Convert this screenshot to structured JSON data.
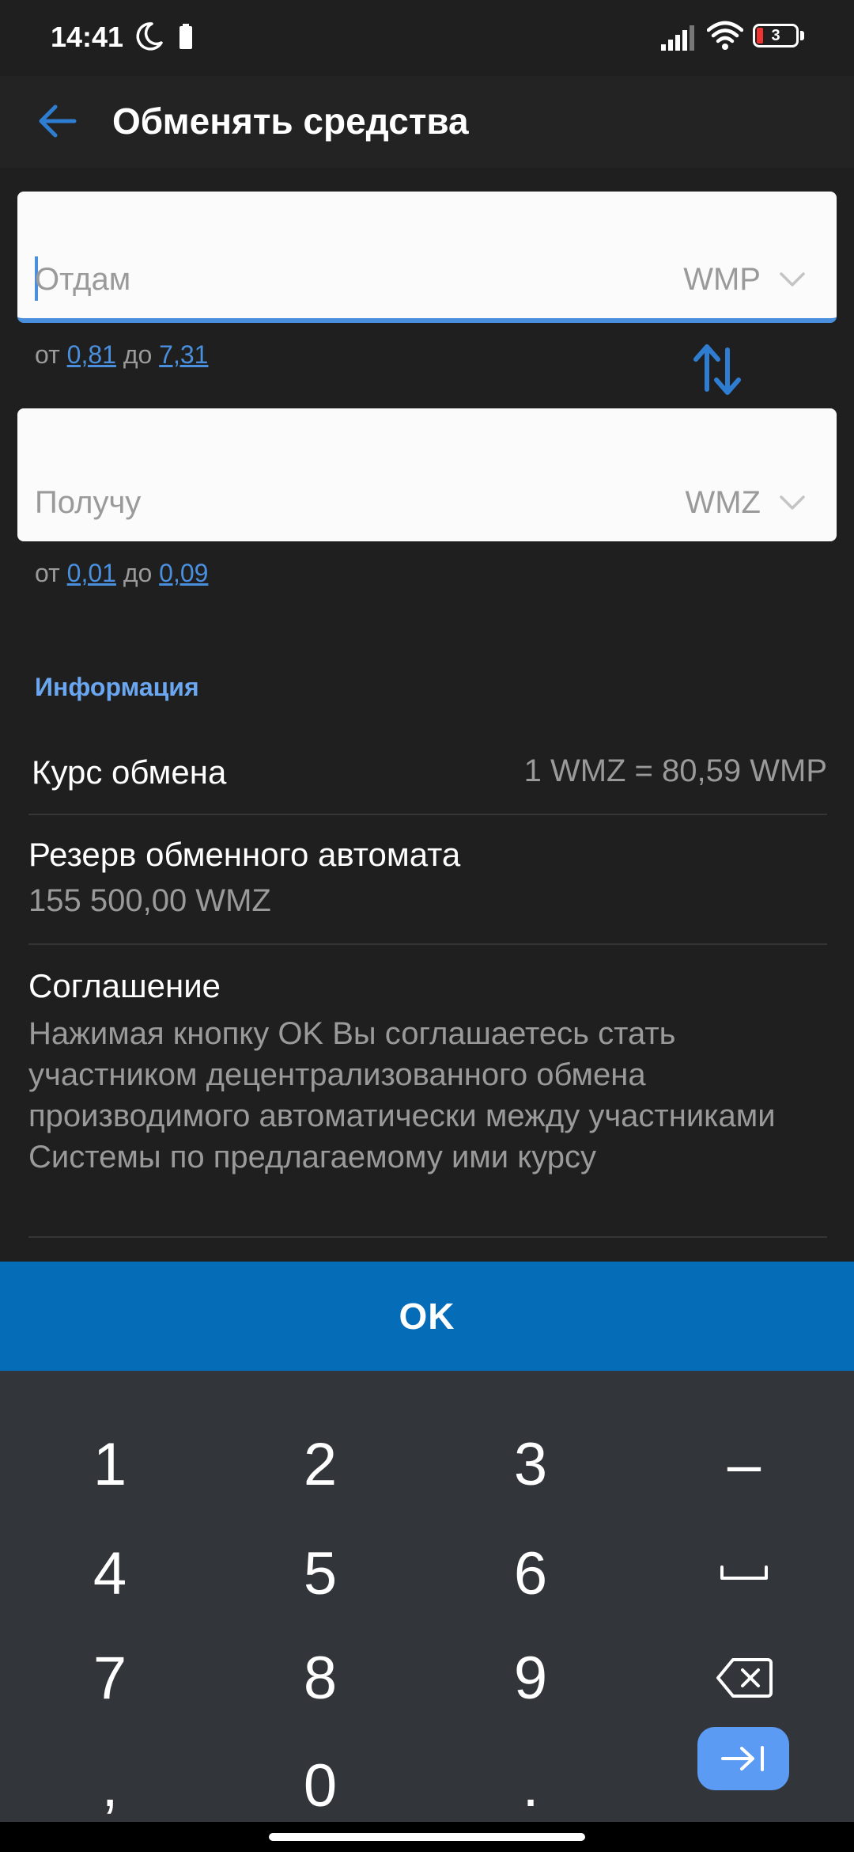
{
  "status_bar": {
    "time": "14:41",
    "battery_level": "3",
    "icons": [
      "moon-icon",
      "battery-saver-icon",
      "signal-icon",
      "wifi-icon",
      "battery-icon"
    ]
  },
  "app_bar": {
    "title": "Обменять средства",
    "back_icon": "arrow-left-icon"
  },
  "give_field": {
    "placeholder": "Отдам",
    "currency": "WMP",
    "value": ""
  },
  "give_range": {
    "from_label": "от",
    "min": "0,81",
    "to_label": "до",
    "max": "7,31"
  },
  "swap_icon": "swap-vertical-icon",
  "get_field": {
    "placeholder": "Получу",
    "currency": "WMZ",
    "value": ""
  },
  "get_range": {
    "from_label": "от",
    "min": "0,01",
    "to_label": "до",
    "max": "0,09"
  },
  "info": {
    "section_title": "Информация",
    "rate_label": "Курс обмена",
    "rate_value": "1 WMZ = 80,59 WMP",
    "reserve_label": "Резерв обменного автомата",
    "reserve_value": "155 500,00 WMZ",
    "agreement_label": "Соглашение",
    "agreement_text": "Нажимая кнопку OK Вы соглашаетесь стать участником децентрализованного обмена производимого автоматически между участниками Системы по предлагаемому ими курсу"
  },
  "ok_button": {
    "label": "OK"
  },
  "keyboard": {
    "keys": [
      "1",
      "2",
      "3",
      "–",
      "4",
      "5",
      "6",
      "space",
      "7",
      "8",
      "9",
      "backspace",
      ",",
      "0",
      ".",
      "next"
    ]
  },
  "colors": {
    "background": "#1f1f1f",
    "accent": "#4a8fdd",
    "ok_button": "#056cb8",
    "keyboard": "#32353a",
    "next_key": "#5c9bf3"
  }
}
